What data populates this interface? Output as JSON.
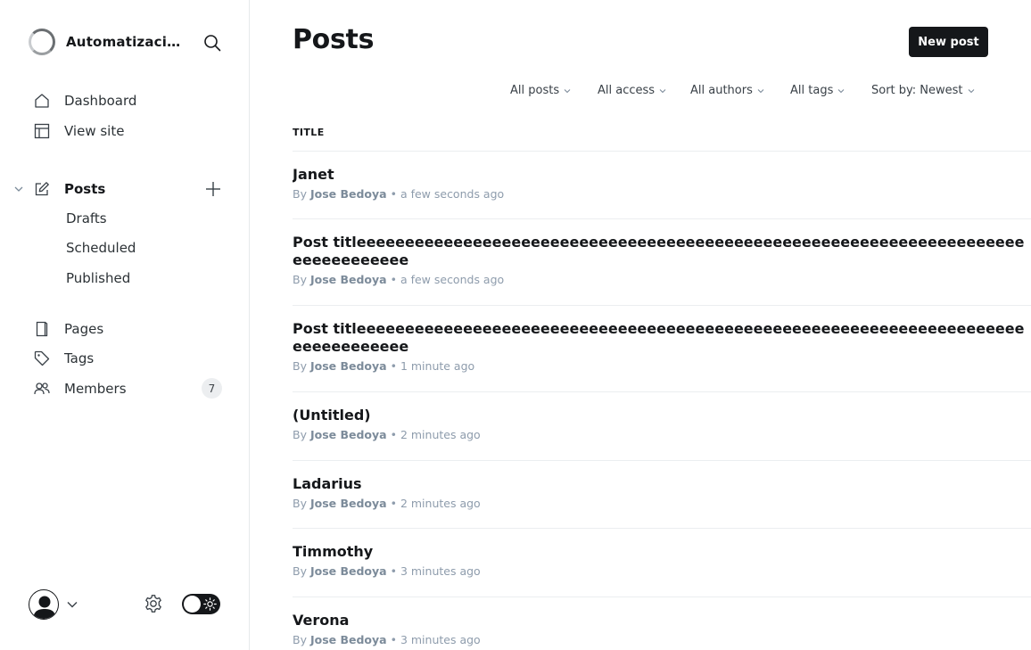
{
  "sidebar": {
    "site_name": "Automatizacion...",
    "nav": {
      "dashboard": "Dashboard",
      "view_site": "View site",
      "posts": "Posts",
      "drafts": "Drafts",
      "scheduled": "Scheduled",
      "published": "Published",
      "pages": "Pages",
      "tags": "Tags",
      "members": "Members",
      "members_count": "7"
    }
  },
  "main": {
    "title": "Posts",
    "new_post_label": "New post",
    "filters": {
      "type": "All posts",
      "access": "All access",
      "authors": "All authors",
      "tags": "All tags",
      "sort": "Sort by: Newest"
    },
    "column_title": "TITLE",
    "posts": [
      {
        "title": "Janet",
        "by": "By",
        "author": "Jose Bedoya",
        "time": "• a few seconds ago"
      },
      {
        "title": "Post titleeeeeeeeeeeeeeeeeeeeeeeeeeeeeeeeeeeeeeeeeeeeeeeeeeeeeeeeeeeeeeeeeeeeeeeeeeeeeeeee",
        "by": "By",
        "author": "Jose Bedoya",
        "time": "• a few seconds ago"
      },
      {
        "title": "Post titleeeeeeeeeeeeeeeeeeeeeeeeeeeeeeeeeeeeeeeeeeeeeeeeeeeeeeeeeeeeeeeeeeeeeeeeeeeeeeeee",
        "by": "By",
        "author": "Jose Bedoya",
        "time": "• 1 minute ago"
      },
      {
        "title": "(Untitled)",
        "by": "By",
        "author": "Jose Bedoya",
        "time": "• 2 minutes ago"
      },
      {
        "title": "Ladarius",
        "by": "By",
        "author": "Jose Bedoya",
        "time": "• 2 minutes ago"
      },
      {
        "title": "Timmothy",
        "by": "By",
        "author": "Jose Bedoya",
        "time": "• 3 minutes ago"
      },
      {
        "title": "Verona",
        "by": "By",
        "author": "Jose Bedoya",
        "time": "• 3 minutes ago"
      }
    ]
  }
}
